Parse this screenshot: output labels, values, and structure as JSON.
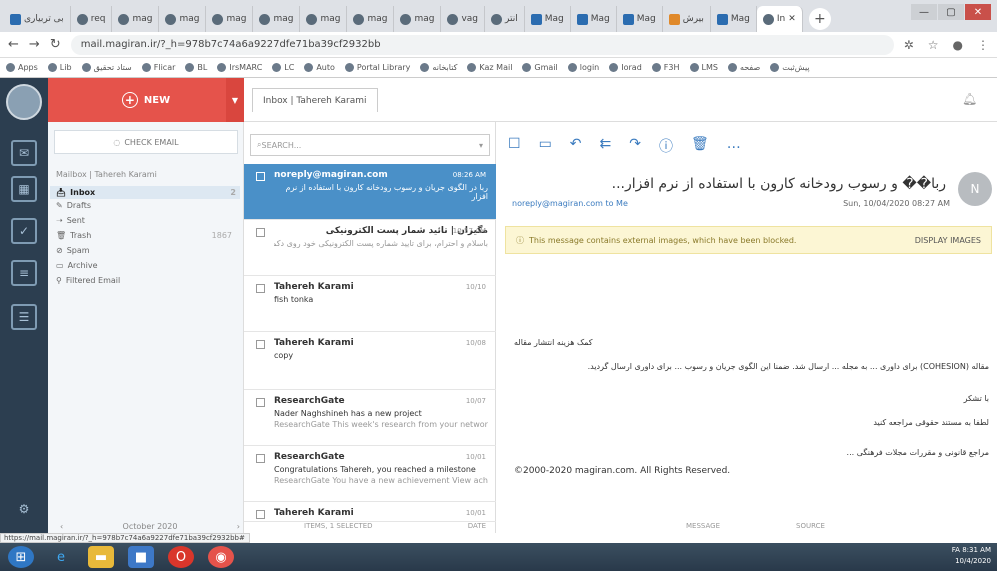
{
  "tabs": [
    {
      "label": "بی تربیاری",
      "fav": "blue"
    },
    {
      "label": "req",
      "fav": "gray"
    },
    {
      "label": "mag",
      "fav": "gray"
    },
    {
      "label": "mag",
      "fav": "gray"
    },
    {
      "label": "mag",
      "fav": "gray"
    },
    {
      "label": "mag",
      "fav": "gray"
    },
    {
      "label": "mag",
      "fav": "gray"
    },
    {
      "label": "mag",
      "fav": "gray"
    },
    {
      "label": "mag",
      "fav": "gray"
    },
    {
      "label": "vag",
      "fav": "gray"
    },
    {
      "label": "انتر",
      "fav": "gray"
    },
    {
      "label": "Mag",
      "fav": "blue"
    },
    {
      "label": "Mag",
      "fav": "blue"
    },
    {
      "label": "Mag",
      "fav": "blue"
    },
    {
      "label": "بیرش",
      "fav": "orange"
    },
    {
      "label": "Mag",
      "fav": "blue"
    },
    {
      "label": "In",
      "fav": "gray",
      "active": true
    }
  ],
  "browser": {
    "url": "mail.magiran.ir/?_h=978b7c74a6a9227dfe71ba39cf2932bb",
    "bookmarks": [
      "Apps",
      "Lib",
      "ستاد تحقیق",
      "Flicar",
      "BL",
      "IrsMARC",
      "LC",
      "Auto",
      "Portal Library",
      "کتابخانه",
      "Kaz Mail",
      "Gmail",
      "login",
      "Iorad",
      "F3H",
      "LMS",
      "صفحه",
      "پیش‌ثبت"
    ],
    "status_url": "https://mail.magiran.ir/?_h=978b7c74a6a9227dfe71ba39cf2932bb#"
  },
  "mail": {
    "new_label": "NEW",
    "breadcrumb": "Inbox | Tahereh Karami",
    "check_mail": "CHECK EMAIL",
    "mailbox_title": "Mailbox | Tahereh Karami",
    "folders": [
      {
        "name": "Inbox",
        "count": "2"
      },
      {
        "name": "Drafts",
        "count": ""
      },
      {
        "name": "Sent",
        "count": ""
      },
      {
        "name": "Trash",
        "count": "1867"
      },
      {
        "name": "Spam",
        "count": ""
      },
      {
        "name": "Archive",
        "count": ""
      },
      {
        "name": "Filtered Email",
        "count": ""
      }
    ],
    "calendar_label": "October 2020",
    "search_placeholder": "SEARCH...",
    "messages": [
      {
        "from": "noreply@magiran.com",
        "time": "08:26 AM",
        "subject": "ربا در الگوی جریان و رسوب رودخانه کارون با استفاده از نرم افزار",
        "preview": "",
        "selected": true
      },
      {
        "from": "مگیران | تائید شمار پست الکترونیکی",
        "time": "10:57 AM",
        "subject": "",
        "preview": "باسلام و احترام، برای تایید شماره پست الکترونیکی خود روی دکمه زیر کلیک",
        "selected": false
      },
      {
        "from": "Tahereh Karami",
        "time": "10/10",
        "subject": "fish tonka",
        "preview": "",
        "selected": false
      },
      {
        "from": "Tahereh Karami",
        "time": "10/08",
        "subject": "copy",
        "preview": "",
        "selected": false
      },
      {
        "from": "ResearchGate",
        "time": "10/07",
        "subject": "Nader Naghshineh has a new project",
        "preview": "ResearchGate This week's research from your network",
        "selected": false
      },
      {
        "from": "ResearchGate",
        "time": "10/01",
        "subject": "Congratulations Tahereh, you reached a milestone",
        "preview": "ResearchGate You have a new achievement View achie",
        "selected": false
      },
      {
        "from": "Tahereh Karami",
        "time": "10/01",
        "subject": "",
        "preview": "",
        "selected": false
      }
    ],
    "list_footer": "ITEMS, 1 SELECTED",
    "list_sort": "DATE",
    "viewer": {
      "subject": "ربا�� و رسوب رودخانه کارون با استفاده از نرم افزار...",
      "from": "noreply@magiran.com",
      "to": "to Me",
      "datetime": "Sun, 10/04/2020 08:27 AM",
      "avatar": "N",
      "alert": "This message contains external images, which have been blocked.",
      "display_images": "DISPLAY IMAGES",
      "body_lines": [
        "کمک هزینه انتشار مقاله",
        "مقاله (COHESION) برای داوری ... به مجله ... ارسال شد. ضمنا این الگوی جریان و رسوب ... برای داوری ارسال گردید.",
        "با تشکر",
        "لطفا به مستند حقوقی مراجعه کنید",
        "مراجع قانونی و مقررات مجلات فرهنگی ...",
        "©2000-2020 magiran.com. All Rights Reserved."
      ],
      "footer_message": "MESSAGE",
      "footer_source": "SOURCE"
    }
  },
  "tray": {
    "lang": "FA",
    "time": "8:31 AM",
    "date": "10/4/2020"
  }
}
